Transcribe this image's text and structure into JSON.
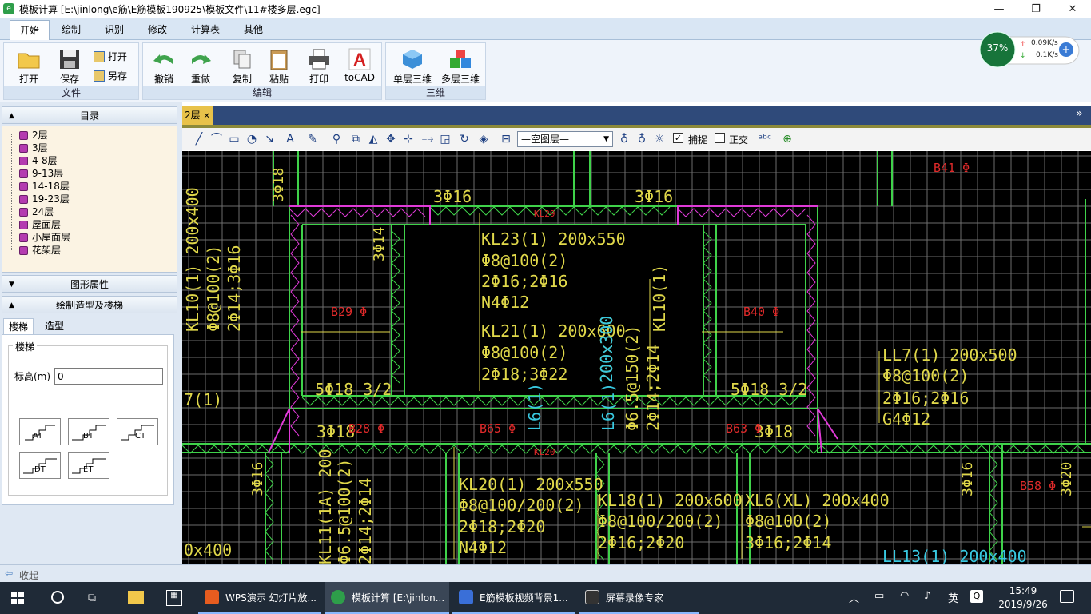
{
  "window": {
    "title": "模板计算 [E:\\jinlong\\e筋\\E筋模板190925\\模板文件\\11#楼多层.egc]",
    "minimize_glyph": "—",
    "maximize_glyph": "❐",
    "close_glyph": "✕"
  },
  "menu": {
    "tabs": [
      "开始",
      "绘制",
      "识别",
      "修改",
      "计算表",
      "其他"
    ]
  },
  "ribbon": {
    "file_group": "文件",
    "edit_group": "编辑",
    "three_d_group": "三维",
    "open": "打开",
    "save": "保存",
    "open_small": "打开",
    "save_as": "另存",
    "undo": "撤销",
    "redo": "重做",
    "copy": "复制",
    "paste": "粘贴",
    "print": "打印",
    "tocad": "toCAD",
    "single_3d": "单层三维",
    "multi_3d": "多层三维"
  },
  "net_widget": {
    "percent": "37%",
    "up": "0.09K/s",
    "down": "0.1K/s"
  },
  "left_panel": {
    "catalog_title": "目录",
    "floors": [
      "2层",
      "3层",
      "4-8层",
      "9-13层",
      "14-18层",
      "19-23层",
      "24层",
      "屋面层",
      "小屋面层",
      "花架层"
    ],
    "shape_props": "图形属性",
    "draw_shape_stairs": "绘制造型及楼梯",
    "stairs_tab": "楼梯",
    "shape_tab": "造型",
    "group_label": "楼梯",
    "elevation_label": "标高(m)",
    "elevation_value": "0",
    "stair_types": [
      "AT",
      "BT",
      "CT",
      "DT",
      "ET"
    ]
  },
  "collapse_label": "收起",
  "drawing": {
    "tab_label": "2层",
    "layer_select": "—空图层—",
    "snap_label": "捕捉",
    "ortho_label": "正交",
    "snap_checked": "✓",
    "expand_glyph": "»",
    "annotations_yellow": [
      "KL23(1) 200x550",
      "Φ8@100(2)",
      "2Φ16;2Φ16",
      "N4Φ12",
      "KL21(1) 200x600",
      "Φ8@100(2)",
      "2Φ18;3Φ22",
      "KL20(1) 200x550",
      "Φ8@100/200(2)",
      "2Φ18;2Φ20",
      "N4Φ12",
      "LL7(1) 200x500",
      "Φ8@100(2)",
      "2Φ16;2Φ16",
      "G4Φ12",
      "KL18(1) 200x600",
      "Φ8@100/200(2)",
      "2Φ16;2Φ20",
      "XL6(XL) 200x400",
      "Φ8@100(2)",
      "3Φ16;2Φ14",
      "KL10(1)",
      "KL10(1) 200x400",
      "Φ8@100(2)",
      "2Φ14;3Φ16",
      "200x300",
      "Φ6.5@150(2)",
      "2Φ14;2Φ14",
      "3Φ16",
      "3Φ16",
      "3Φ14",
      "5Φ18 3/2",
      "5Φ18 3/2",
      "3Φ18",
      "3Φ18",
      "3Φ16",
      "3Φ16",
      "3Φ20",
      "3Φ18",
      "7(1)",
      "0x400",
      "KL11(1A) 200",
      "Φ6.5@100(2)",
      "2Φ14;2Φ14"
    ],
    "annotations_red": [
      "B41 Φ",
      "B29 Φ",
      "B40 Φ",
      "B65 Φ",
      "B63 Φ",
      "B58 Φ",
      "B28 Φ",
      "KL29",
      "KL20"
    ],
    "annotations_cyan": [
      "L6(1)",
      "L6(1)",
      "LL13(1) 200x400",
      "200x300"
    ]
  },
  "taskbar": {
    "tasks": [
      "WPS演示 幻灯片放...",
      "模板计算 [E:\\jinlon...",
      "E筋模板视频背景1...",
      "屏幕录像专家"
    ],
    "time": "15:49",
    "date": "2019/9/26",
    "ime": "英"
  }
}
